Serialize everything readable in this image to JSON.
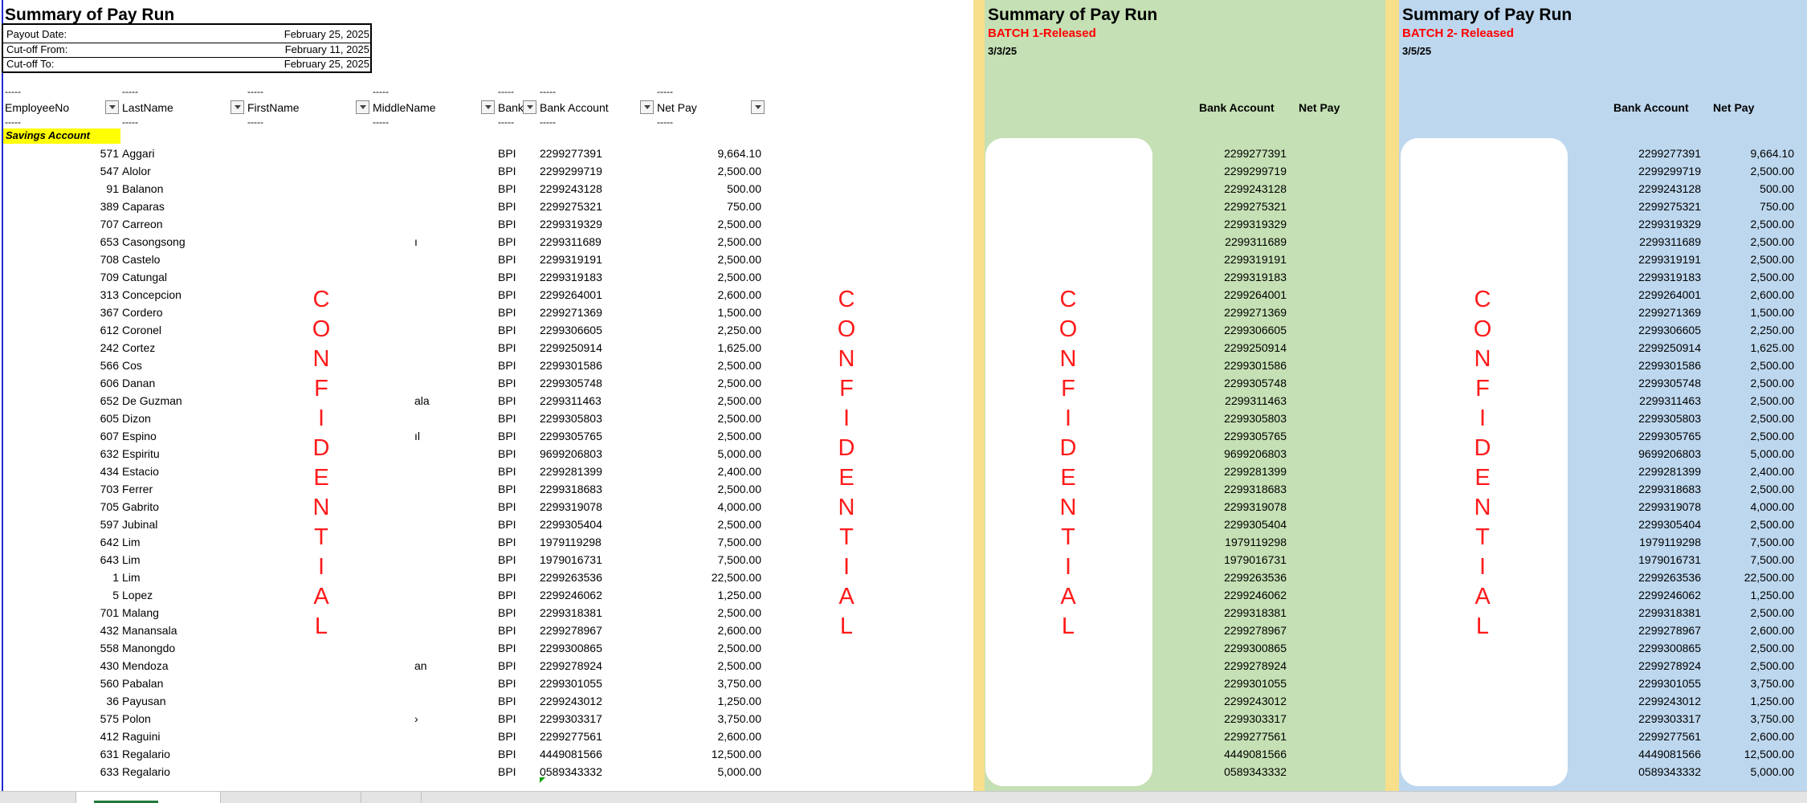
{
  "main": {
    "title": "Summary of Pay Run",
    "info": [
      {
        "label": "Payout Date:",
        "value": "February 25, 2025"
      },
      {
        "label": "Cut-off From:",
        "value": "February 11, 2025"
      },
      {
        "label": "Cut-off To:",
        "value": "February 25, 2025"
      }
    ],
    "dash": "-----",
    "headers": {
      "employee_no": "EmployeeNo",
      "last_name": "LastName",
      "first_name": "FirstName",
      "middle_name": "MiddleName",
      "bank": "Bank",
      "bank_account": "Bank Account",
      "net_pay": "Net Pay"
    },
    "section_label": "Savings Account"
  },
  "batch1": {
    "title": "Summary of Pay Run",
    "label": "BATCH 1-Released",
    "date": "3/3/25",
    "headers": {
      "bank_account": "Bank Account",
      "net_pay": "Net Pay"
    }
  },
  "batch2": {
    "title": "Summary of Pay Run",
    "label": "BATCH 2- Released",
    "date": "3/5/25",
    "headers": {
      "bank_account": "Bank Account",
      "net_pay": "Net Pay"
    }
  },
  "confidential_letters": [
    "C",
    "O",
    "N",
    "F",
    "I",
    "D",
    "E",
    "N",
    "T",
    "I",
    "A",
    "L"
  ],
  "rows": [
    {
      "emp": "571",
      "last": "Aggari",
      "mid": "",
      "bank": "BPI",
      "acct": "2299277391",
      "net": "9,664.10"
    },
    {
      "emp": "547",
      "last": "Alolor",
      "mid": "",
      "bank": "BPI",
      "acct": "2299299719",
      "net": "2,500.00"
    },
    {
      "emp": "91",
      "last": "Balanon",
      "mid": "",
      "bank": "BPI",
      "acct": "2299243128",
      "net": "500.00"
    },
    {
      "emp": "389",
      "last": "Caparas",
      "mid": "",
      "bank": "BPI",
      "acct": "2299275321",
      "net": "750.00"
    },
    {
      "emp": "707",
      "last": "Carreon",
      "mid": "",
      "bank": "BPI",
      "acct": "2299319329",
      "net": "2,500.00"
    },
    {
      "emp": "653",
      "last": "Casongsong",
      "mid": "ı",
      "bank": "BPI",
      "acct": "2299311689",
      "net": "2,500.00"
    },
    {
      "emp": "708",
      "last": "Castelo",
      "mid": "",
      "bank": "BPI",
      "acct": "2299319191",
      "net": "2,500.00"
    },
    {
      "emp": "709",
      "last": "Catungal",
      "mid": "",
      "bank": "BPI",
      "acct": "2299319183",
      "net": "2,500.00"
    },
    {
      "emp": "313",
      "last": "Concepcion",
      "mid": "",
      "bank": "BPI",
      "acct": "2299264001",
      "net": "2,600.00"
    },
    {
      "emp": "367",
      "last": "Cordero",
      "mid": "",
      "bank": "BPI",
      "acct": "2299271369",
      "net": "1,500.00"
    },
    {
      "emp": "612",
      "last": "Coronel",
      "mid": "",
      "bank": "BPI",
      "acct": "2299306605",
      "net": "2,250.00"
    },
    {
      "emp": "242",
      "last": "Cortez",
      "mid": "",
      "bank": "BPI",
      "acct": "2299250914",
      "net": "1,625.00"
    },
    {
      "emp": "566",
      "last": "Cos",
      "mid": "",
      "bank": "BPI",
      "acct": "2299301586",
      "net": "2,500.00"
    },
    {
      "emp": "606",
      "last": "Danan",
      "mid": "",
      "bank": "BPI",
      "acct": "2299305748",
      "net": "2,500.00"
    },
    {
      "emp": "652",
      "last": "De Guzman",
      "mid": "ala",
      "bank": "BPI",
      "acct": "2299311463",
      "net": "2,500.00"
    },
    {
      "emp": "605",
      "last": "Dizon",
      "mid": "",
      "bank": "BPI",
      "acct": "2299305803",
      "net": "2,500.00"
    },
    {
      "emp": "607",
      "last": "Espino",
      "mid": "ıl",
      "bank": "BPI",
      "acct": "2299305765",
      "net": "2,500.00"
    },
    {
      "emp": "632",
      "last": "Espiritu",
      "mid": "",
      "bank": "BPI",
      "acct": "9699206803",
      "net": "5,000.00"
    },
    {
      "emp": "434",
      "last": "Estacio",
      "mid": "",
      "bank": "BPI",
      "acct": "2299281399",
      "net": "2,400.00"
    },
    {
      "emp": "703",
      "last": "Ferrer",
      "mid": "",
      "bank": "BPI",
      "acct": "2299318683",
      "net": "2,500.00"
    },
    {
      "emp": "705",
      "last": "Gabrito",
      "mid": "",
      "bank": "BPI",
      "acct": "2299319078",
      "net": "4,000.00"
    },
    {
      "emp": "597",
      "last": "Jubinal",
      "mid": "",
      "bank": "BPI",
      "acct": "2299305404",
      "net": "2,500.00"
    },
    {
      "emp": "642",
      "last": "Lim",
      "mid": "",
      "bank": "BPI",
      "acct": "1979119298",
      "net": "7,500.00"
    },
    {
      "emp": "643",
      "last": "Lim",
      "mid": "",
      "bank": "BPI",
      "acct": "1979016731",
      "net": "7,500.00"
    },
    {
      "emp": "1",
      "last": "Lim",
      "mid": "",
      "bank": "BPI",
      "acct": "2299263536",
      "net": "22,500.00"
    },
    {
      "emp": "5",
      "last": "Lopez",
      "mid": "",
      "bank": "BPI",
      "acct": "2299246062",
      "net": "1,250.00"
    },
    {
      "emp": "701",
      "last": "Malang",
      "mid": "",
      "bank": "BPI",
      "acct": "2299318381",
      "net": "2,500.00"
    },
    {
      "emp": "432",
      "last": "Manansala",
      "mid": "",
      "bank": "BPI",
      "acct": "2299278967",
      "net": "2,600.00"
    },
    {
      "emp": "558",
      "last": "Manongdo",
      "mid": "",
      "bank": "BPI",
      "acct": "2299300865",
      "net": "2,500.00"
    },
    {
      "emp": "430",
      "last": "Mendoza",
      "mid": "an",
      "bank": "BPI",
      "acct": "2299278924",
      "net": "2,500.00"
    },
    {
      "emp": "560",
      "last": "Pabalan",
      "mid": "",
      "bank": "BPI",
      "acct": "2299301055",
      "net": "3,750.00"
    },
    {
      "emp": "36",
      "last": "Payusan",
      "mid": "",
      "bank": "BPI",
      "acct": "2299243012",
      "net": "1,250.00"
    },
    {
      "emp": "575",
      "last": "Polon",
      "mid": "›",
      "bank": "BPI",
      "acct": "2299303317",
      "net": "3,750.00"
    },
    {
      "emp": "412",
      "last": "Raguini",
      "mid": "",
      "bank": "BPI",
      "acct": "2299277561",
      "net": "2,600.00"
    },
    {
      "emp": "631",
      "last": "Regalario",
      "mid": "",
      "bank": "BPI",
      "acct": "4449081566",
      "net": "12,500.00"
    },
    {
      "emp": "633",
      "last": "Regalario",
      "mid": "",
      "bank": "BPI",
      "acct": "0589343332",
      "net": "5,000.00"
    }
  ],
  "sheet_tabs": [
    {
      "label": ""
    },
    {
      "label": ""
    },
    {
      "label": ""
    },
    {
      "label": ""
    }
  ],
  "colors": {
    "batch1_panel": "#c5e0b4",
    "batch2_panel": "#bdd7ee",
    "separator": "#f7df8c",
    "confidential": "#ff1a1a",
    "highlight": "#ffff00"
  }
}
